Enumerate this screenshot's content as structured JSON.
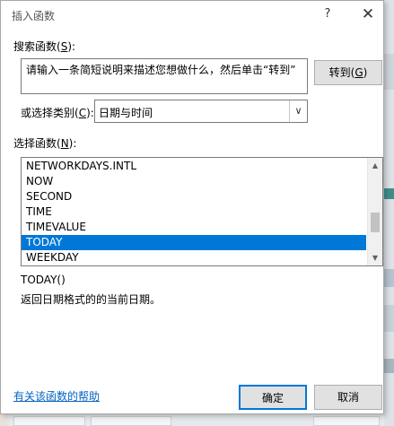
{
  "dialog": {
    "title": "插入函数",
    "help_glyph": "?",
    "close_glyph": "✕"
  },
  "search": {
    "label_prefix": "搜索函数(",
    "label_key": "S",
    "label_suffix": "):",
    "value": "请输入一条简短说明来描述您想做什么，然后单击“转到”",
    "goto_prefix": "转到(",
    "goto_key": "G",
    "goto_suffix": ")"
  },
  "category": {
    "label_prefix": "或选择类别(",
    "label_key": "C",
    "label_suffix": "):",
    "selected": "日期与时间"
  },
  "functions": {
    "label_prefix": "选择函数(",
    "label_key": "N",
    "label_suffix": "):",
    "items": [
      "NETWORKDAYS.INTL",
      "NOW",
      "SECOND",
      "TIME",
      "TIMEVALUE",
      "TODAY",
      "WEEKDAY"
    ],
    "selected": "TODAY"
  },
  "details": {
    "signature": "TODAY()",
    "description": "返回日期格式的的当前日期。"
  },
  "footer": {
    "help_link": "有关该函数的帮助",
    "ok_label": "确定",
    "cancel_label": "取消"
  },
  "colors": {
    "selection": "#0078d7",
    "link": "#0563c1"
  }
}
